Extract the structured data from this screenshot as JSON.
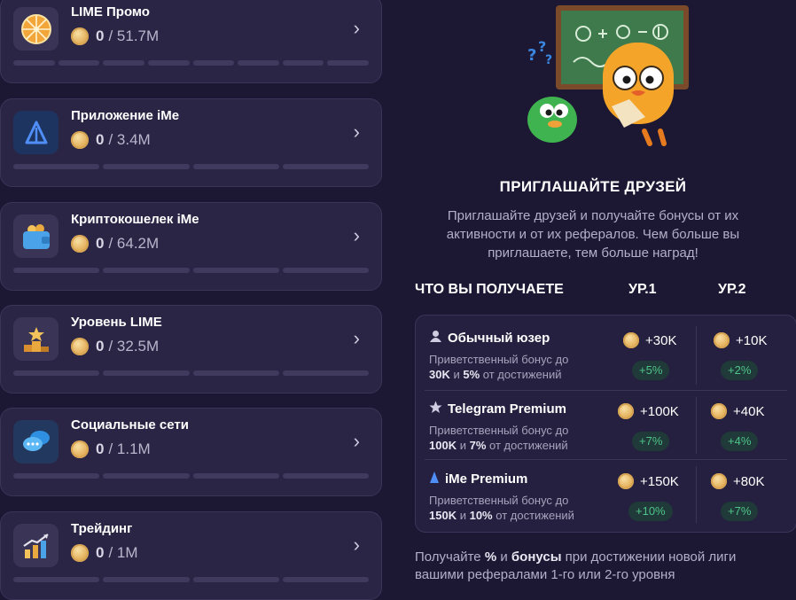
{
  "tasks": [
    {
      "title": "LIME Промо",
      "current": "0",
      "total": "/ 51.7M",
      "icon": "wheel-icon"
    },
    {
      "title": "Приложение iMe",
      "current": "0",
      "total": "/ 3.4M",
      "icon": "ime-app-icon"
    },
    {
      "title": "Криптокошелек iMe",
      "current": "0",
      "total": "/ 64.2M",
      "icon": "wallet-icon"
    },
    {
      "title": "Уровень LIME",
      "current": "0",
      "total": "/ 32.5M",
      "icon": "podium-icon"
    },
    {
      "title": "Социальные сети",
      "current": "0",
      "total": "/ 1.1M",
      "icon": "chat-bubbles-icon"
    },
    {
      "title": "Трейдинг",
      "current": "0",
      "total": "/ 1M",
      "icon": "trading-chart-icon"
    }
  ],
  "invite": {
    "title": "ПРИГЛАШАЙТЕ ДРУЗЕЙ",
    "description": "Приглашайте друзей и получайте бонусы от их активности и от их рефералов. Чем больше вы приглашаете, тем больше наград!"
  },
  "table": {
    "header": "ЧТО ВЫ ПОЛУЧАЕТЕ",
    "lvl1": "УР.1",
    "lvl2": "УР.2",
    "rows": [
      {
        "name": "Обычный юзер",
        "icon": "user-icon",
        "desc_prefix": "Приветственный бонус до",
        "desc_amount": "30K",
        "desc_and": "и",
        "desc_pct": "5%",
        "desc_suffix": "от достижений",
        "l1": "+30K",
        "l1_pct": "+5%",
        "l2": "+10K",
        "l2_pct": "+2%"
      },
      {
        "name": "Telegram Premium",
        "icon": "star-icon",
        "desc_prefix": "Приветственный бонус до",
        "desc_amount": "100K",
        "desc_and": "и",
        "desc_pct": "7%",
        "desc_suffix": "от достижений",
        "l1": "+100K",
        "l1_pct": "+7%",
        "l2": "+40K",
        "l2_pct": "+4%"
      },
      {
        "name": "iMe Premium",
        "icon": "ime-premium-icon",
        "desc_prefix": "Приветственный бонус до",
        "desc_amount": "150K",
        "desc_and": "и",
        "desc_pct": "10%",
        "desc_suffix": "от достижений",
        "l1": "+150K",
        "l1_pct": "+10%",
        "l2": "+80K",
        "l2_pct": "+7%"
      }
    ]
  },
  "footer": {
    "p1": "Получайте",
    "b1": "%",
    "p2": "и",
    "b2": "бонусы",
    "p3": "при достижении новой лиги вашими рефералами 1-го или 2-го уровня"
  },
  "colors": {
    "background": "#1c1833",
    "card": "#2a2545",
    "accent_green": "#4fc48a",
    "coin": "#e3b05c"
  }
}
